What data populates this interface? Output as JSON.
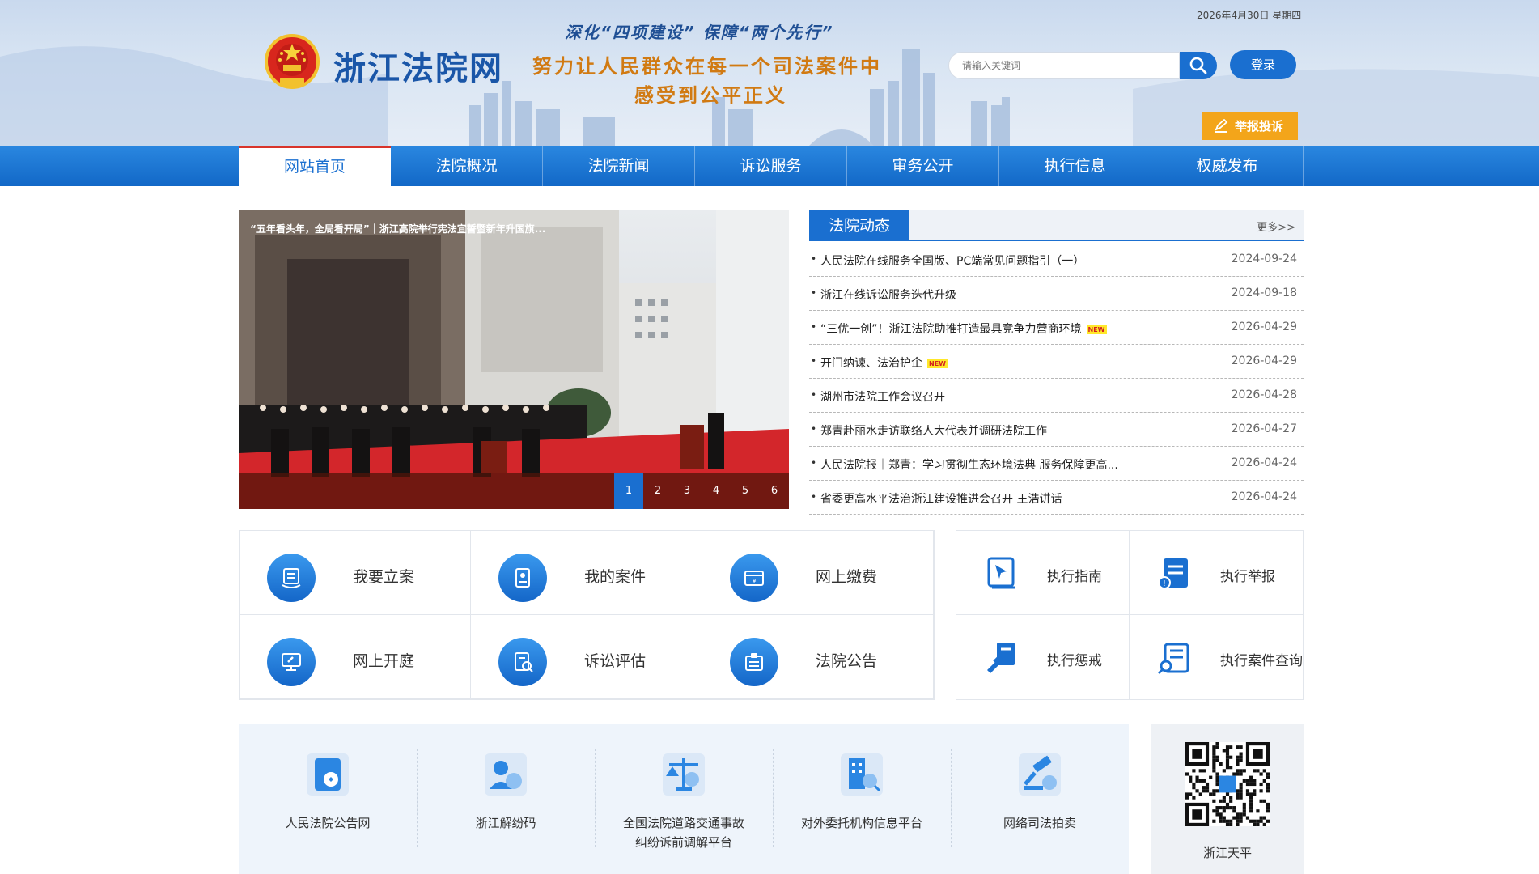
{
  "header": {
    "date": "2026年4月30日 星期四",
    "site_name": "浙江法院网",
    "slogan_line1": "深化“四项建设” 保障“两个先行”",
    "slogan_line2": "努力让人民群众在每一个司法案件中",
    "slogan_line3": "感受到公平正义",
    "search_placeholder": "请输入关键词",
    "login_label": "登录",
    "report_label": "举报投诉"
  },
  "nav": {
    "items": [
      {
        "label": "网站首页",
        "active": true
      },
      {
        "label": "法院概况"
      },
      {
        "label": "法院新闻"
      },
      {
        "label": "诉讼服务"
      },
      {
        "label": "审务公开"
      },
      {
        "label": "执行信息"
      },
      {
        "label": "权威发布"
      }
    ]
  },
  "carousel": {
    "caption": "“五年看头年，全局看开局”｜浙江高院举行宪法宣誓暨新年升国旗...",
    "dots": [
      "1",
      "2",
      "3",
      "4",
      "5",
      "6"
    ],
    "active_index": 0
  },
  "news": {
    "title": "法院动态",
    "more": "更多>>",
    "new_tag": "NEW",
    "items": [
      {
        "title": "人民法院在线服务全国版、PC端常见问题指引（一）",
        "date": "2024-09-24"
      },
      {
        "title": "浙江在线诉讼服务迭代升级",
        "date": "2024-09-18"
      },
      {
        "title": "“三优一创”！浙江法院助推打造最具竞争力营商环境",
        "date": "2026-04-29",
        "is_new": true
      },
      {
        "title": "开门纳谏、法治护企",
        "date": "2026-04-29",
        "is_new": true
      },
      {
        "title": "湖州市法院工作会议召开",
        "date": "2026-04-28"
      },
      {
        "title": "郑青赴丽水走访联络人大代表并调研法院工作",
        "date": "2026-04-27"
      },
      {
        "title": "人民法院报｜郑青：学习贯彻生态环境法典 服务保障更高...",
        "date": "2026-04-24"
      },
      {
        "title": "省委更高水平法治浙江建设推进会召开 王浩讲话",
        "date": "2026-04-24"
      }
    ]
  },
  "services": {
    "items": [
      {
        "label": "我要立案",
        "icon": "file-case-icon"
      },
      {
        "label": "我的案件",
        "icon": "document-icon"
      },
      {
        "label": "网上缴费",
        "icon": "payment-icon"
      },
      {
        "label": "网上开庭",
        "icon": "online-court-icon"
      },
      {
        "label": "诉讼评估",
        "icon": "assessment-icon"
      },
      {
        "label": "法院公告",
        "icon": "announcement-icon"
      }
    ]
  },
  "execution": {
    "items": [
      {
        "label": "执行指南",
        "icon": "guide-icon"
      },
      {
        "label": "执行举报",
        "icon": "report-icon"
      },
      {
        "label": "执行惩戒",
        "icon": "gavel-icon"
      },
      {
        "label": "执行案件查询",
        "icon": "query-icon"
      }
    ]
  },
  "platforms": {
    "items": [
      {
        "label": "人民法院公告网",
        "icon": "notice-site-icon"
      },
      {
        "label": "浙江解纷码",
        "icon": "dispute-code-icon"
      },
      {
        "label": "全国法院道路交通事故\n纠纷诉前调解平台",
        "icon": "traffic-mediation-icon"
      },
      {
        "label": "对外委托机构信息平台",
        "icon": "agency-info-icon"
      },
      {
        "label": "网络司法拍卖",
        "icon": "auction-icon"
      }
    ]
  },
  "qr": {
    "label": "浙江天平"
  },
  "colors": {
    "primary": "#1a6fd0",
    "accent_orange": "#f3a51a",
    "slogan_orange": "#d17a12",
    "nav_active_border": "#d9342b"
  }
}
